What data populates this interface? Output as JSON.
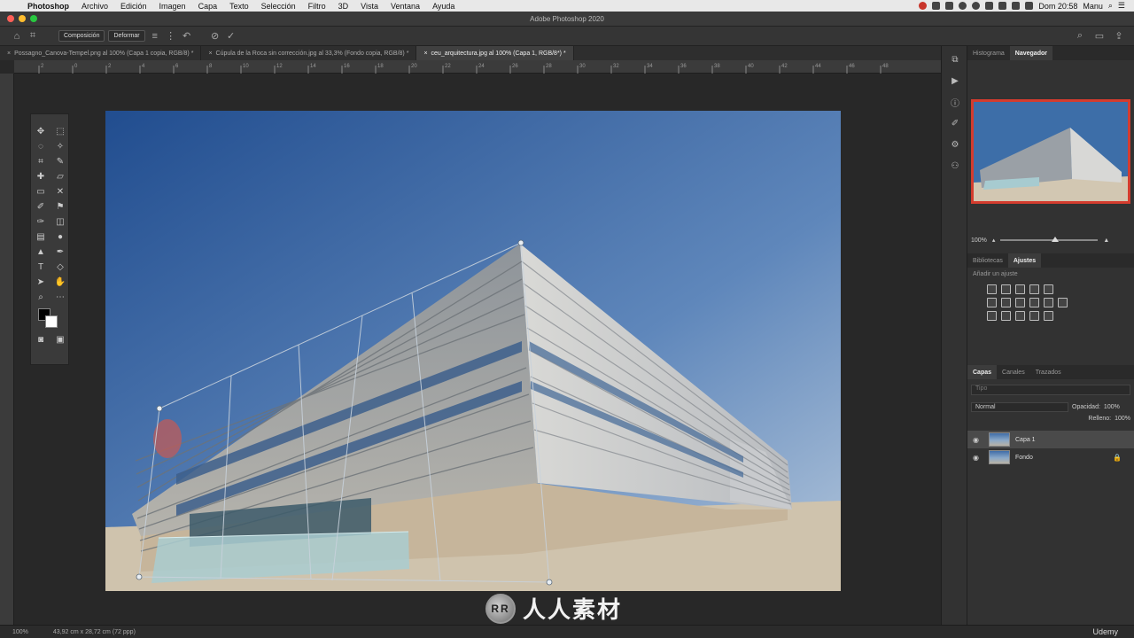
{
  "menubar": {
    "app": "Photoshop",
    "items": [
      "Archivo",
      "Edición",
      "Imagen",
      "Capa",
      "Texto",
      "Selección",
      "Filtro",
      "3D",
      "Vista",
      "Ventana",
      "Ayuda"
    ],
    "clock": "Dom 20:58",
    "user": "Manu"
  },
  "window": {
    "title": "Adobe Photoshop 2020"
  },
  "options": {
    "composicion": "Composición",
    "deformar": "Deformar"
  },
  "tabs": [
    {
      "label": "Possagno_Canova-Tempel.png al 100% (Capa 1 copia, RGB/8) *"
    },
    {
      "label": "Cúpula de la Roca sin corrección.jpg al 33,3% (Fondo copia, RGB/8) *"
    },
    {
      "label": "ceu_arquitectura.jpg al 100% (Capa 1, RGB/8*) *"
    }
  ],
  "ruler": {
    "h_ticks": [
      "2",
      "0",
      "2",
      "4",
      "6",
      "8",
      "10",
      "12",
      "14",
      "16",
      "18",
      "20",
      "22",
      "24",
      "26",
      "28",
      "30",
      "32",
      "34",
      "36",
      "38",
      "40",
      "42",
      "44",
      "46",
      "48"
    ]
  },
  "navigator": {
    "tab_hist": "Histograma",
    "tab_nav": "Navegador",
    "zoom": "100%"
  },
  "adjust": {
    "tab_lib": "Bibliotecas",
    "tab_adj": "Ajustes",
    "hint": "Añadir un ajuste"
  },
  "layers": {
    "tab_layers": "Capas",
    "tab_channels": "Canales",
    "tab_paths": "Trazados",
    "search": "Tipo",
    "blend": "Normal",
    "opacity_label": "Opacidad:",
    "opacity": "100%",
    "fill_label": "Relleno:",
    "fill": "100%",
    "items": [
      {
        "name": "Capa 1"
      },
      {
        "name": "Fondo"
      }
    ]
  },
  "status": {
    "zoom": "100%",
    "docsize": "43,92 cm x 28,72 cm (72 ppp)",
    "brand": "Udemy"
  },
  "watermark": {
    "text": "人人素材",
    "logo": "RR"
  },
  "colors": {
    "accent": "#d43c2e",
    "sky_top": "#2d5c9c",
    "sky_bottom": "#a9c0d8"
  }
}
